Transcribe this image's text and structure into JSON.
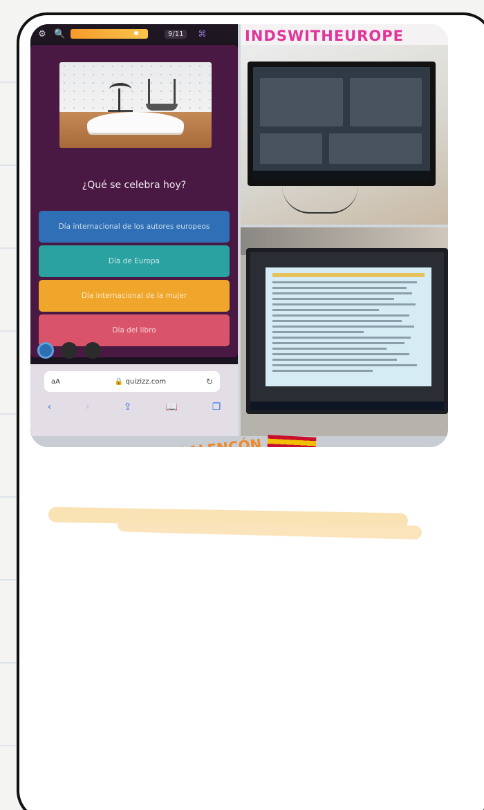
{
  "quiz": {
    "score": "9/11",
    "question": "¿Qué se celebra hoy?",
    "options": [
      "Día internacional de los autores europeos",
      "Día de Europa",
      "Día internacional de la mujer",
      "Día del libro"
    ]
  },
  "browser": {
    "text_size": "aA",
    "url": "quizizz.com"
  },
  "photos": {
    "banner": "INDSWITHEUROPE",
    "bottom_label": "DALENCÓN"
  },
  "colors": {
    "quiz_bg": "#4a1943",
    "option_blue": "#2e6fb6",
    "option_teal": "#2aa2a2",
    "option_orange": "#f0a62b",
    "option_red": "#d9546a",
    "banner_pink": "#e0359a",
    "highlighter": "#f9e0b0"
  },
  "icons": [
    "settings-icon",
    "zoom-icon",
    "bookmark-icon",
    "reload-icon",
    "back-icon",
    "forward-icon",
    "share-icon",
    "bookmarks-icon",
    "tabs-icon"
  ]
}
